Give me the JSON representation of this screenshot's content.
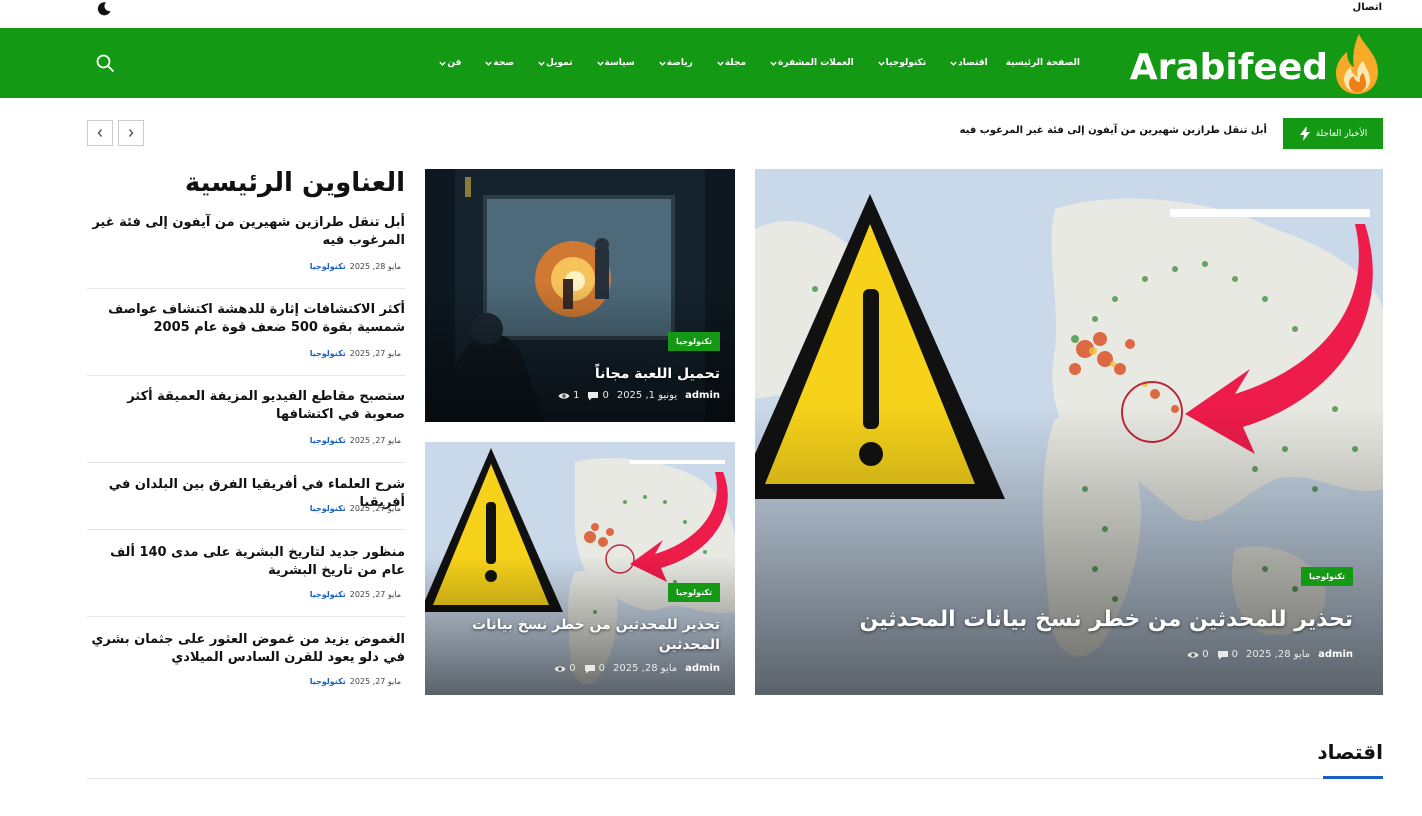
{
  "topbar": {
    "contact_label": "اتصال"
  },
  "brand": {
    "logo_text": "Arabifeed",
    "accent_color": "#139914"
  },
  "nav": {
    "items": [
      {
        "label": "الصفحة الرئيسية",
        "has_dropdown": false
      },
      {
        "label": "اقتصاد",
        "has_dropdown": true
      },
      {
        "label": "تكنولوجيا",
        "has_dropdown": true
      },
      {
        "label": "العملات المشفرة",
        "has_dropdown": true
      },
      {
        "label": "مجلة",
        "has_dropdown": true
      },
      {
        "label": "رياضة",
        "has_dropdown": true
      },
      {
        "label": "سياسة",
        "has_dropdown": true
      },
      {
        "label": "تمويل",
        "has_dropdown": true
      },
      {
        "label": "صحة",
        "has_dropdown": true
      },
      {
        "label": "فن",
        "has_dropdown": true
      }
    ]
  },
  "ticker": {
    "label": "الأخبار العاجلة",
    "headline": "أبل تنقل طرازين شهيرين من آيفون إلى فئة غير المرغوب فيه"
  },
  "featured": {
    "main": {
      "category": "تكنولوجيا",
      "title": "تحذير للمحدثين من خطر نسخ بيانات المحدثين",
      "author": "admin",
      "date": "مايو 28, 2025",
      "comments": "0",
      "views": "0"
    },
    "top_right": {
      "category": "تكنولوجيا",
      "title": "تحميل اللعبة مجاناً",
      "author": "admin",
      "date": "يونيو 1, 2025",
      "comments": "0",
      "views": "1"
    },
    "bottom_right": {
      "category": "تكنولوجيا",
      "title": "تحذير للمحدثين من خطر نسخ بيانات المحدثين",
      "author": "admin",
      "date": "مايو 28, 2025",
      "comments": "0",
      "views": "0"
    }
  },
  "sidebar": {
    "title": "العناوين الرئيسية",
    "items": [
      {
        "title": "أبل تنقل طرازين شهيرين من آيفون إلى فئة غير المرغوب فيه",
        "category": "تكنولوجيا",
        "date": "مايو 28, 2025"
      },
      {
        "title": "أكثر الاكتشافات إثارة للدهشة اكتشاف عواصف شمسية بقوة 500 ضعف قوة عام 2005",
        "category": "تكنولوجيا",
        "date": "مايو 27, 2025"
      },
      {
        "title": "ستصبح مقاطع الفيديو المزيفة العميقة أكثر صعوبة في اكتشافها",
        "category": "تكنولوجيا",
        "date": "مايو 27, 2025"
      },
      {
        "title": "شرح العلماء في أفريقيا الفرق بين البلدان في أفريقيا",
        "category": "تكنولوجيا",
        "date": "مايو 27, 2025"
      },
      {
        "title": "منظور جديد لتاريخ البشرية على مدى 140 ألف عام من تاريخ البشرية",
        "category": "تكنولوجيا",
        "date": "مايو 27, 2025"
      },
      {
        "title": "الغموض يزيد من غموض العثور على جثمان بشري في دلو يعود للقرن السادس الميلادي",
        "category": "تكنولوجيا",
        "date": "مايو 27, 2025"
      }
    ]
  },
  "section": {
    "title": "اقتصاد"
  }
}
